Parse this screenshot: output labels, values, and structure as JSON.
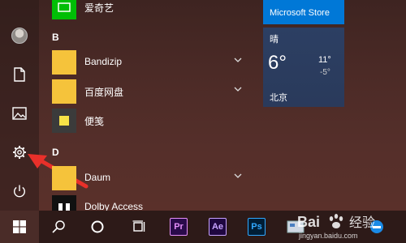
{
  "app_list": {
    "top_partial": {
      "label": "爱奇艺",
      "tile_color": "#00be06"
    },
    "group_b": {
      "letter": "B"
    },
    "bandizip": {
      "label": "Bandizip",
      "tile_color": "#f5c33b"
    },
    "baidu_netdisk": {
      "label": "百度网盘",
      "tile_color": "#f5c33b"
    },
    "sticky_notes": {
      "label": "便笺",
      "tile_color": "#3b3b3b"
    },
    "group_d": {
      "letter": "D"
    },
    "daum": {
      "label": "Daum",
      "tile_color": "#f5c33b"
    },
    "dolby": {
      "label": "Dolby Access",
      "tile_color": "#111111"
    }
  },
  "tiles": {
    "store": {
      "label": "Microsoft Store",
      "color": "#0078d7"
    },
    "weather": {
      "condition": "晴",
      "temperature": "6°",
      "high": "11°",
      "low": "-5°",
      "city": "北京"
    }
  },
  "rail": {
    "items": [
      {
        "name": "user-avatar"
      },
      {
        "name": "documents-icon"
      },
      {
        "name": "pictures-icon"
      },
      {
        "name": "settings-icon"
      },
      {
        "name": "power-icon"
      }
    ]
  },
  "taskbar": {
    "premiere": {
      "label": "Pr",
      "color": "#2a0b4b",
      "text_color": "#e58ff9"
    },
    "after_effects": {
      "label": "Ae",
      "color": "#1f0740",
      "text_color": "#c7a3ff"
    },
    "photoshop": {
      "label": "Ps",
      "color": "#001e36",
      "text_color": "#31a8ff"
    }
  },
  "watermark": {
    "text": "Bai 经验",
    "url": "jingyan.baidu.com"
  },
  "colors": {
    "annotation_arrow": "#e8302a",
    "accent": "#0078d7"
  }
}
